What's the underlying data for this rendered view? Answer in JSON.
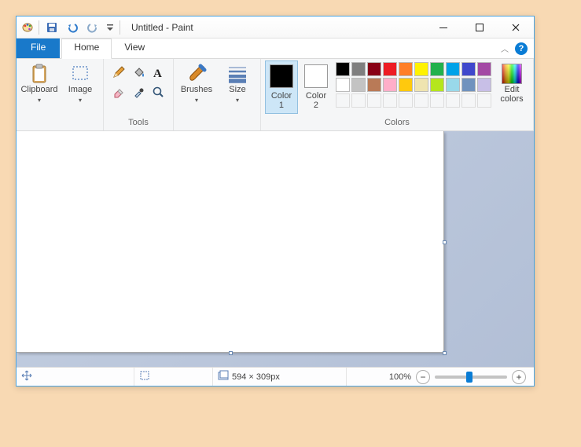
{
  "title": "Untitled - Paint",
  "tabs": {
    "file": "File",
    "home": "Home",
    "view": "View"
  },
  "ribbon": {
    "clipboard": {
      "label": "Clipboard"
    },
    "image": {
      "label": "Image"
    },
    "tools_group": "Tools",
    "brushes": {
      "label": "Brushes"
    },
    "size": {
      "label": "Size"
    },
    "color1": {
      "label": "Color\n1"
    },
    "color2": {
      "label": "Color\n2"
    },
    "colors_group": "Colors",
    "edit_colors": {
      "label": "Edit\ncolors"
    }
  },
  "palette_row1": [
    "#000000",
    "#7f7f7f",
    "#880015",
    "#ed1c24",
    "#ff7f27",
    "#fff200",
    "#22b14c",
    "#00a2e8",
    "#3f48cc",
    "#a349a4"
  ],
  "palette_row2": [
    "#ffffff",
    "#c3c3c3",
    "#b97a57",
    "#ffaec9",
    "#ffc90e",
    "#efe4b0",
    "#b5e61d",
    "#99d9ea",
    "#7092be",
    "#c8bfe7"
  ],
  "status": {
    "dimensions": "594 × 309px",
    "zoom": "100%"
  },
  "help": "?"
}
